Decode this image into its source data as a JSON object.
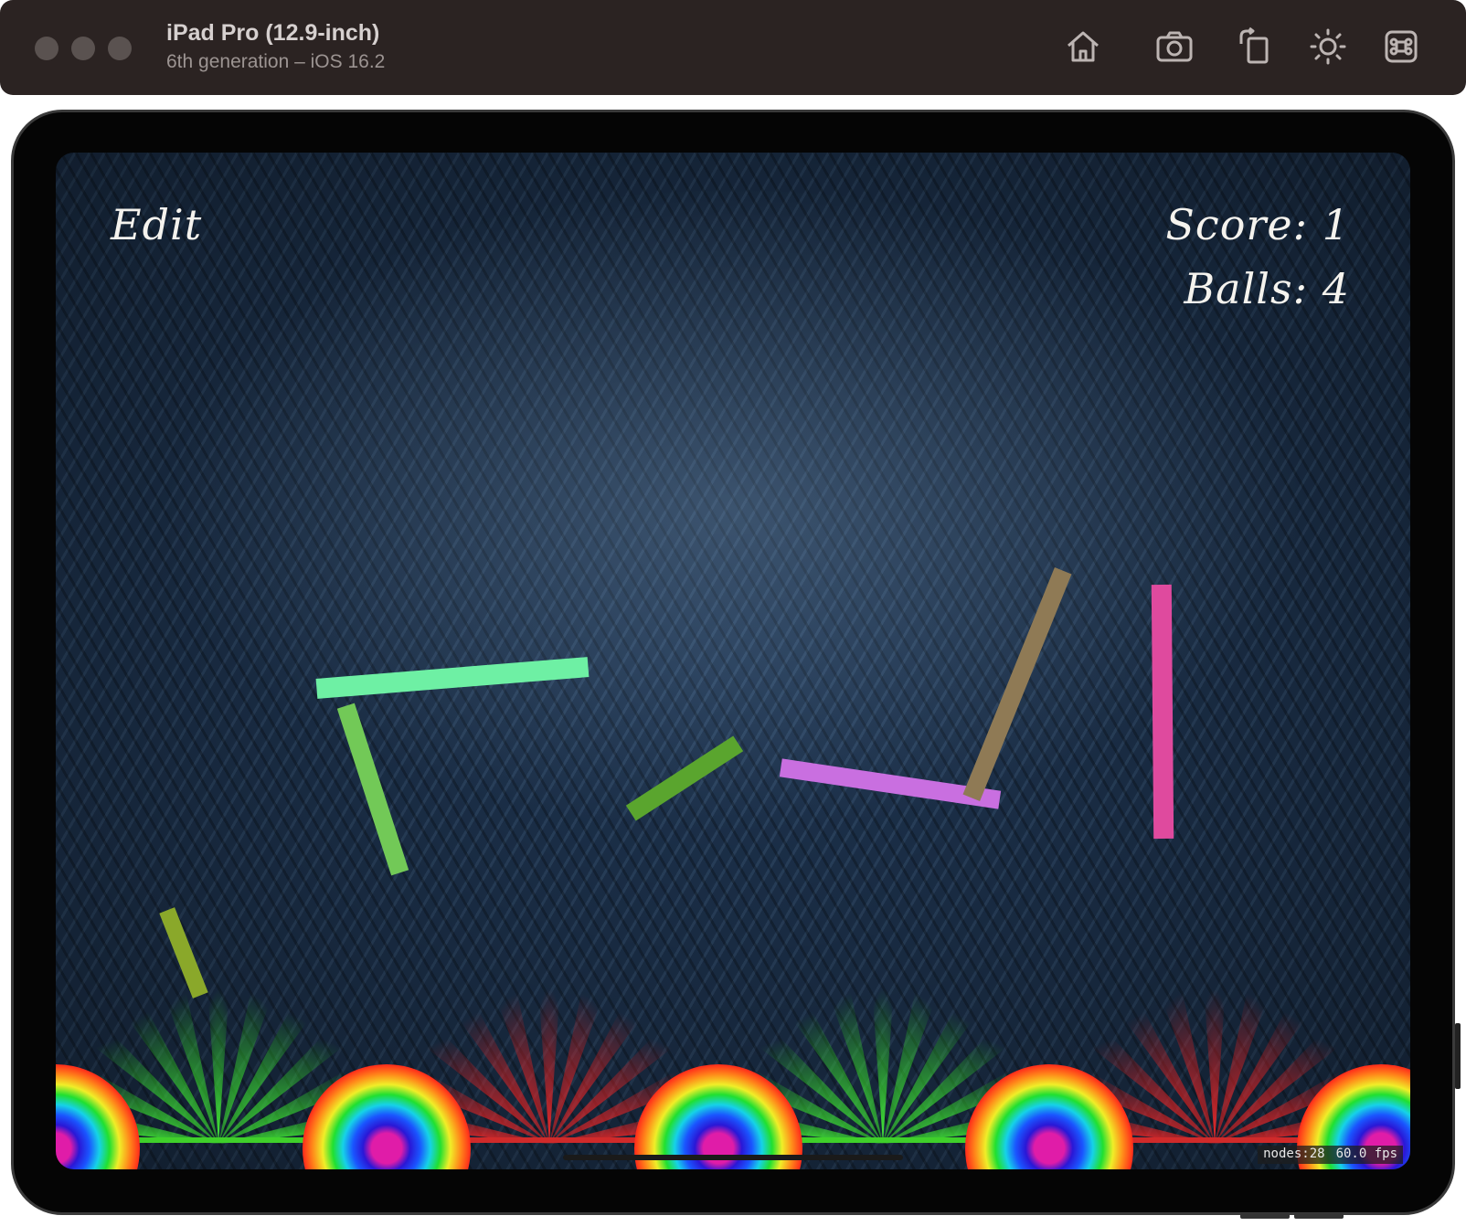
{
  "window": {
    "device_name": "iPad Pro (12.9-inch)",
    "device_subtitle": "6th generation – iOS 16.2",
    "toolbar_icons": [
      "home-icon",
      "screenshot-icon",
      "rotate-icon",
      "brightness-icon",
      "command-icon"
    ]
  },
  "hud": {
    "edit_label": "Edit",
    "score_label": "Score: 1",
    "balls_label": "Balls: 4"
  },
  "bars": [
    {
      "name": "mint-bar",
      "color": "#6ef0a4"
    },
    {
      "name": "green-bar-a",
      "color": "#72c957"
    },
    {
      "name": "green-bar-b",
      "color": "#5aa52e"
    },
    {
      "name": "olive-bar",
      "color": "#8aa82a"
    },
    {
      "name": "violet-bar",
      "color": "#c96fe0"
    },
    {
      "name": "brown-bar",
      "color": "#8f7a55"
    },
    {
      "name": "pink-bar",
      "color": "#df4a9e"
    }
  ],
  "slots": [
    {
      "name": "slot-good-1",
      "kind": "good"
    },
    {
      "name": "slot-bad-1",
      "kind": "bad"
    },
    {
      "name": "slot-good-2",
      "kind": "good"
    },
    {
      "name": "slot-bad-2",
      "kind": "bad"
    }
  ],
  "debug": {
    "nodes": "nodes:28",
    "fps": "60.0 fps"
  }
}
